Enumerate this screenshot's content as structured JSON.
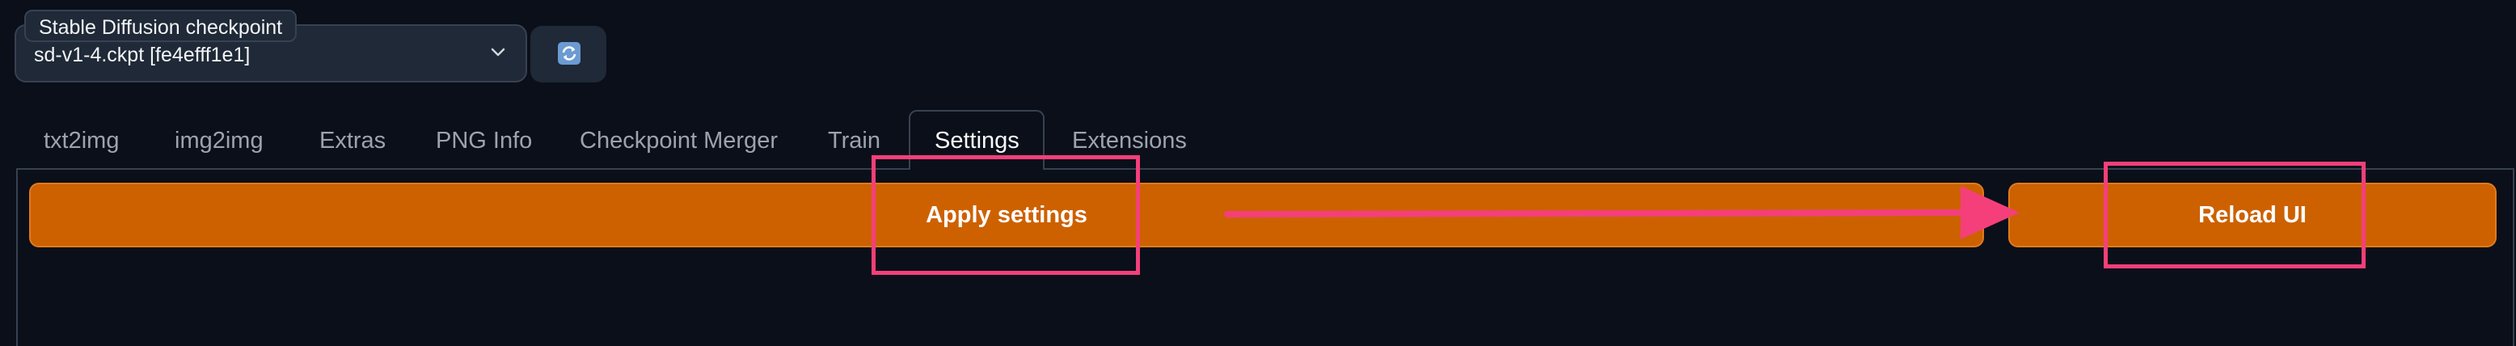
{
  "checkpoint": {
    "label": "Stable Diffusion checkpoint",
    "selected_value": "sd-v1-4.ckpt [fe4efff1e1]"
  },
  "tabs": [
    {
      "label": "txt2img"
    },
    {
      "label": "img2img"
    },
    {
      "label": "Extras"
    },
    {
      "label": "PNG Info"
    },
    {
      "label": "Checkpoint Merger"
    },
    {
      "label": "Train"
    },
    {
      "label": "Settings",
      "active": true
    },
    {
      "label": "Extensions"
    }
  ],
  "settings": {
    "apply_label": "Apply settings",
    "reload_label": "Reload UI"
  },
  "colors": {
    "background": "#0b0f19",
    "button_orange": "#cd6100",
    "annotation_pink": "#f43f7a",
    "refresh_icon_blue": "#6b9bd1"
  }
}
